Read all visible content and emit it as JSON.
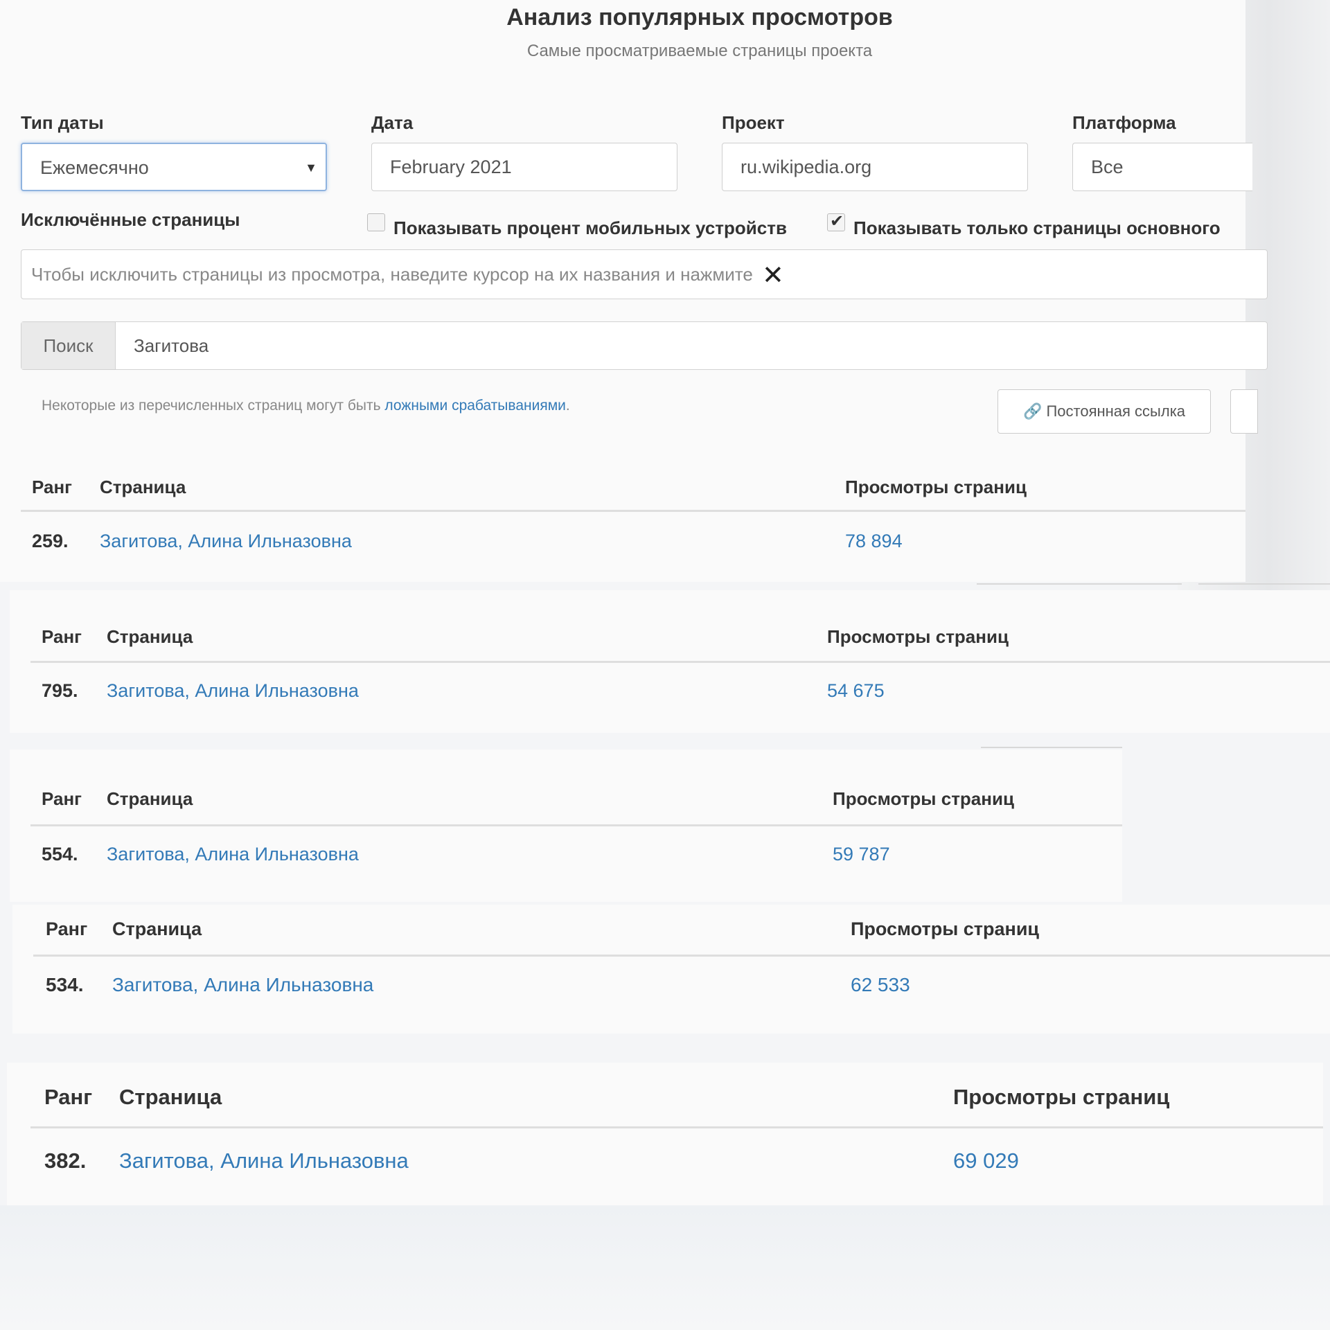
{
  "header": {
    "title": "Анализ популярных просмотров",
    "subtitle": "Самые просматриваемые страницы проекта"
  },
  "filters": {
    "date_type_label": "Тип даты",
    "date_type_value": "Ежемесячно",
    "date_label": "Дата",
    "date_value": "February 2021",
    "project_label": "Проект",
    "project_value": "ru.wikipedia.org",
    "platform_label": "Платформа",
    "platform_value": "Все"
  },
  "options": {
    "excluded_label": "Исключённые страницы",
    "mobile_percent_label": "Показывать процент мобильных устройств",
    "mobile_percent_checked": false,
    "main_only_label": "Показывать только страницы основного",
    "main_only_checked": true,
    "exclude_placeholder": "Чтобы исключить страницы из просмотра, наведите курсор на их названия и нажмите",
    "exclude_icon": "close-icon"
  },
  "search": {
    "addon_label": "Поиск",
    "value": "Загитова"
  },
  "note": {
    "text": "Некоторые из перечисленных страниц могут быть",
    "link": "ложными срабатываниями",
    "suffix": "."
  },
  "actions": {
    "permalink_label": "Постоянная ссылка",
    "permalink_icon": "link-icon"
  },
  "table_headers": {
    "rank": "Ранг",
    "page": "Страница",
    "views": "Просмотры страниц"
  },
  "results": [
    {
      "rank": "259.",
      "page": "Загитова, Алина Ильназовна",
      "views": "78 894"
    },
    {
      "rank": "795.",
      "page": "Загитова, Алина Ильназовна",
      "views": "54 675"
    },
    {
      "rank": "554.",
      "page": "Загитова, Алина Ильназовна",
      "views": "59 787"
    },
    {
      "rank": "534.",
      "page": "Загитова, Алина Ильназовна",
      "views": "62 533"
    },
    {
      "rank": "382.",
      "page": "Загитова, Алина Ильназовна",
      "views": "69 029"
    }
  ],
  "colors": {
    "link": "#337ab7",
    "text": "#333333",
    "muted": "#888888",
    "focus_border": "#8fb3df"
  }
}
